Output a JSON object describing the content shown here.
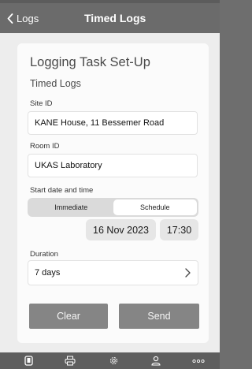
{
  "nav": {
    "back_label": "Logs",
    "title": "Timed Logs"
  },
  "form": {
    "heading": "Logging Task Set-Up",
    "subheading": "Timed Logs",
    "site_id": {
      "label": "Site ID",
      "value": "KANE House, 11 Bessemer Road"
    },
    "room_id": {
      "label": "Room ID",
      "value": "UKAS Laboratory"
    },
    "start": {
      "label": "Start date and time",
      "options": [
        "Immediate",
        "Schedule"
      ],
      "selected": "Schedule",
      "date": "16 Nov 2023",
      "time": "17:30"
    },
    "duration": {
      "label": "Duration",
      "value": "7 days"
    },
    "clear_label": "Clear",
    "send_label": "Send"
  },
  "tabbar": {
    "items": [
      "device-icon",
      "printer-icon",
      "gear-icon",
      "user-icon",
      "more-icon"
    ]
  },
  "colors": {
    "navbar": "#6b6b6b",
    "button": "#858585",
    "tabbar": "#5e5e5e",
    "background": "#ededed"
  }
}
